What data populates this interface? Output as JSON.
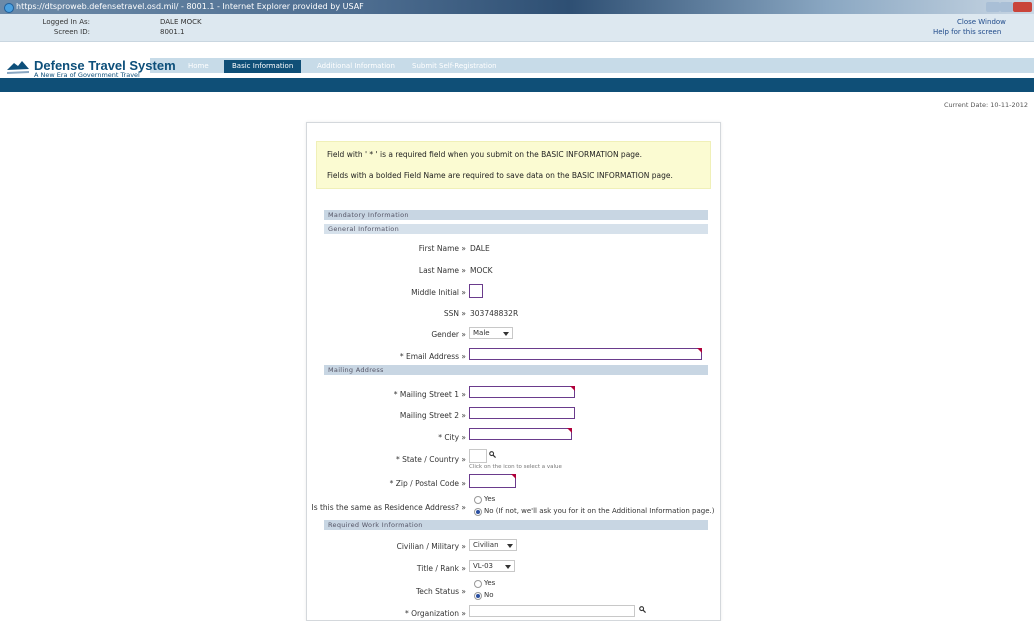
{
  "window": {
    "title": "https://dtsproweb.defensetravel.osd.mil/ - 8001.1 - Internet Explorer provided by USAF"
  },
  "infobar": {
    "logged_in_label": "Logged In As:",
    "logged_in_value": "DALE MOCK",
    "screen_id_label": "Screen ID:",
    "screen_id_value": "8001.1",
    "close_window": "Close Window",
    "help": "Help for this screen"
  },
  "brand": {
    "title": "Defense Travel System",
    "subtitle": "A New Era of Government Travel"
  },
  "tabs": [
    {
      "label": "Home"
    },
    {
      "label": "Basic Information"
    },
    {
      "label": "Additional Information"
    },
    {
      "label": "Submit Self-Registration"
    }
  ],
  "current_date": "Current Date: 10-11-2012",
  "notice": {
    "line1": "Field with ' * ' is a required field when you submit on the BASIC INFORMATION page.",
    "line2": "Fields with a bolded Field Name are required to save data on the BASIC INFORMATION page."
  },
  "sections": {
    "mandatory": "Mandatory Information",
    "general": "General Information",
    "mailing": "Mailing Address",
    "work": "Required Work Information"
  },
  "fields": {
    "first_name": {
      "label": "First Name »",
      "value": "DALE"
    },
    "last_name": {
      "label": "Last Name »",
      "value": "MOCK"
    },
    "middle_initial": {
      "label": "Middle Initial »",
      "value": ""
    },
    "ssn": {
      "label": "SSN »",
      "value": "303748832R"
    },
    "gender": {
      "label": "Gender »",
      "value": "Male"
    },
    "email": {
      "label": "* Email Address »",
      "value": ""
    },
    "street1": {
      "label": "* Mailing Street 1 »",
      "value": ""
    },
    "street2": {
      "label": "Mailing Street 2 »",
      "value": ""
    },
    "city": {
      "label": "* City »",
      "value": ""
    },
    "state": {
      "label": "* State / Country »",
      "value": "",
      "hint": "Click on the icon to select a value"
    },
    "zip": {
      "label": "* Zip / Postal Code »",
      "value": ""
    },
    "same_as_residence": {
      "label": "Is this the same as Residence Address? »",
      "options": [
        "Yes",
        "No (If not, we'll ask you for it on the Additional Information page.)"
      ],
      "selected": 1
    },
    "civ_mil": {
      "label": "Civilian / Military »",
      "value": "Civilian"
    },
    "title_rank": {
      "label": "Title / Rank »",
      "value": "VL-03"
    },
    "tech_status": {
      "label": "Tech Status »",
      "options": [
        "Yes",
        "No"
      ],
      "selected": 1
    },
    "organization": {
      "label": "* Organization »",
      "value": ""
    }
  },
  "colors": {
    "brand_dark": "#0f4f77",
    "nav_light": "#c7dbe8",
    "required_marker": "#b0003a",
    "notice_bg": "#fbfbd2"
  }
}
